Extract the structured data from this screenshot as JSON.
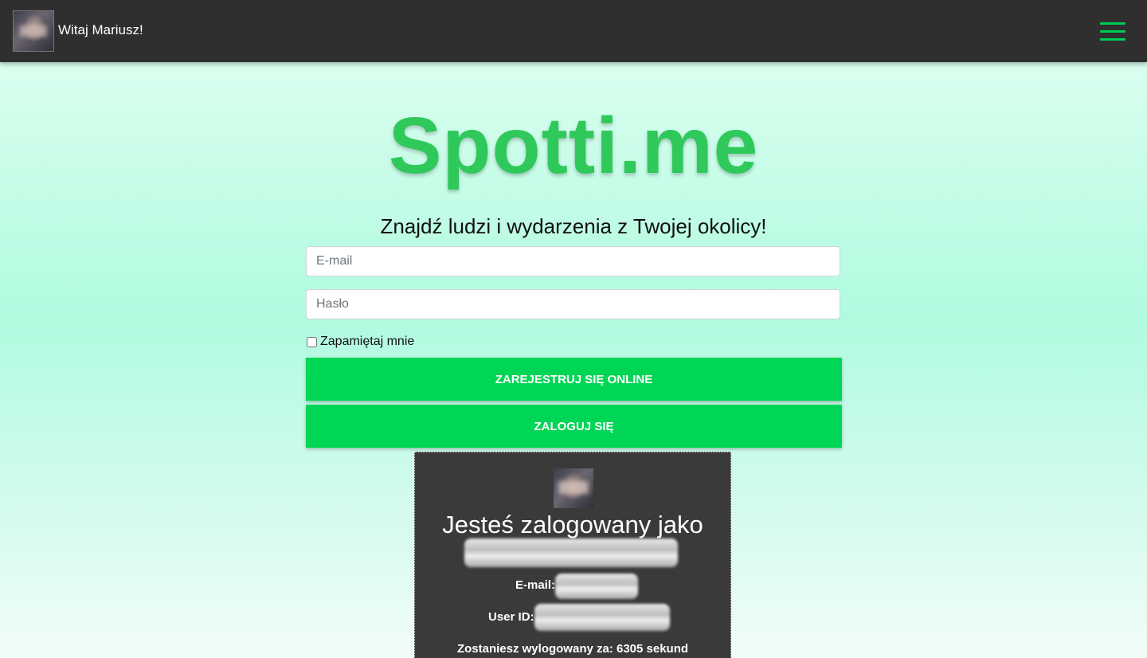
{
  "navbar": {
    "greeting": "Witaj Mariusz!",
    "menu_icon": "hamburger-menu-icon",
    "accent_color": "#00cc55"
  },
  "hero": {
    "brand": "Spotti.me",
    "tagline": "Znajdź ludzi i wydarzenia z Twojej okolicy!",
    "brand_color": "#2ec95a"
  },
  "form": {
    "email_placeholder": "E-mail",
    "email_value": "",
    "password_placeholder": "Hasło",
    "password_value": "",
    "remember_label": "Zapamiętaj mnie",
    "remember_checked": false,
    "register_label": "ZAREJESTRUJ SIĘ ONLINE",
    "login_label": "ZALOGUJ SIĘ",
    "button_color": "#00d655"
  },
  "session": {
    "title": "Jesteś zalogowany jako",
    "email_label": "E-mail:",
    "userid_label": "User ID:",
    "logout_text": "Zostaniesz wylogowany za: 6305 sekund"
  }
}
